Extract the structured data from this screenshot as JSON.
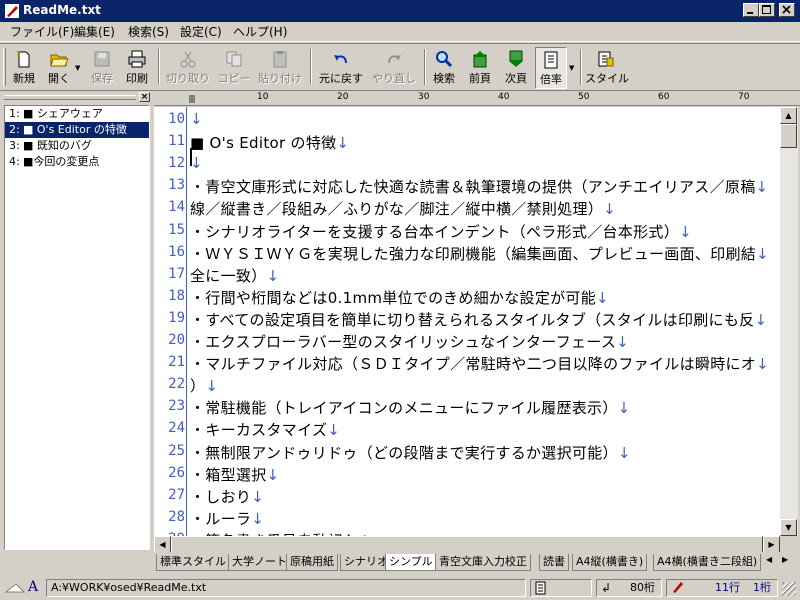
{
  "window": {
    "title": "ReadMe.txt"
  },
  "menu": [
    "ファイル(F)",
    "編集(E)",
    "検索(S)",
    "設定(C)",
    "ヘルプ(H)"
  ],
  "toolbar": {
    "new": "新規",
    "open": "開く",
    "save": "保存",
    "print": "印刷",
    "cut": "切り取り",
    "copy": "コピー",
    "paste": "貼り付け",
    "undo": "元に戻す",
    "redo": "やり直し",
    "search": "検索",
    "prev_page": "前頁",
    "next_page": "次頁",
    "zoom": "倍率",
    "style": "スタイル"
  },
  "outline": [
    {
      "num": "1:",
      "label": "■ シェアウェア"
    },
    {
      "num": "2:",
      "label": "■ O's Editor の特徴"
    },
    {
      "num": "3:",
      "label": "■ 既知のバグ"
    },
    {
      "num": "4:",
      "label": "■今回の変更点"
    }
  ],
  "ruler": [
    "10",
    "20",
    "30",
    "40",
    "50",
    "60",
    "70"
  ],
  "editor": {
    "lines": [
      {
        "num": "10",
        "text": ""
      },
      {
        "num": "11",
        "text": "■ O's Editor の特徴"
      },
      {
        "num": "12",
        "text": ""
      },
      {
        "num": "13",
        "text": "・青空文庫形式に対応した快適な読書＆執筆環境の提供（アンチエイリアス／原稿"
      },
      {
        "num": "14",
        "text": "線／縦書き／段組み／ふりがな／脚注／縦中横／禁則処理）"
      },
      {
        "num": "15",
        "text": "・シナリオライターを支援する台本インデント（ペラ形式／台本形式）"
      },
      {
        "num": "16",
        "text": "・ＷＹＳＩＷＹＧを実現した強力な印刷機能（編集画面、プレビュー画面、印刷結"
      },
      {
        "num": "17",
        "text": "全に一致）"
      },
      {
        "num": "18",
        "text": "・行間や桁間などは0.1mm単位でのきめ細かな設定が可能"
      },
      {
        "num": "19",
        "text": "・すべての設定項目を簡単に切り替えられるスタイルタブ（スタイルは印刷にも反"
      },
      {
        "num": "20",
        "text": "・エクスプローラバー型のスタイリッシュなインターフェース"
      },
      {
        "num": "21",
        "text": "・マルチファイル対応（ＳＤＩタイプ／常駐時や二つ目以降のファイルは瞬時にオ"
      },
      {
        "num": "22",
        "text": "）"
      },
      {
        "num": "23",
        "text": "・常駐機能（トレイアイコンのメニューにファイル履歴表示）"
      },
      {
        "num": "24",
        "text": "・キーカスタマイズ"
      },
      {
        "num": "25",
        "text": "・無制限アンドゥリドゥ（どの段階まで実行するか選択可能）"
      },
      {
        "num": "26",
        "text": "・箱型選択"
      },
      {
        "num": "27",
        "text": "・しおり"
      },
      {
        "num": "28",
        "text": "・ルーラ"
      },
      {
        "num": "29",
        "text": "・箇条書き番号自動記入"
      }
    ],
    "eol_mark": "↓"
  },
  "style_tabs": [
    "標準スタイル",
    "大学ノート",
    "原稿用紙",
    "シナリオ",
    "シンプル",
    "青空文庫入力校正",
    "読書",
    "A4縦(横書き)",
    "A4横(横書き二段組)"
  ],
  "active_style_tab": "シンプル",
  "status": {
    "path": "A:¥WORK¥osed¥ReadMe.txt",
    "columns": "80桁",
    "line": "11行",
    "column": "1桁"
  },
  "colors": {
    "title_bar": "#0a246a",
    "line_numbers": "#4060c0",
    "selection": "#0a246a"
  }
}
